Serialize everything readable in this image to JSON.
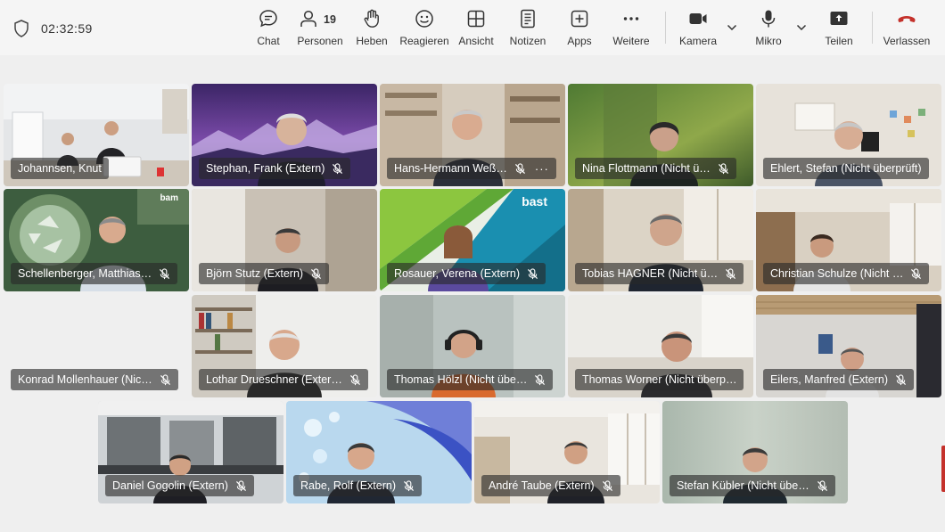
{
  "meeting": {
    "timer": "02:32:59"
  },
  "toolbar": {
    "chat": "Chat",
    "people": "Personen",
    "people_count": "19",
    "raise_hand": "Heben",
    "react": "Reagieren",
    "view": "Ansicht",
    "notes": "Notizen",
    "apps": "Apps",
    "more": "Weitere",
    "camera": "Kamera",
    "mic": "Mikro",
    "share": "Teilen",
    "leave": "Verlassen"
  },
  "tiles": [
    {
      "name": "Johannsen, Knut",
      "muted": false,
      "scene": "office-desk"
    },
    {
      "name": "Stephan, Frank (Extern)",
      "muted": true,
      "scene": "purple-mountains"
    },
    {
      "name": "Hans-Hermann Weß…",
      "muted": true,
      "more": "···",
      "scene": "library"
    },
    {
      "name": "Nina Flottmann (Nicht ü…",
      "muted": true,
      "scene": "green-blur"
    },
    {
      "name": "Ehlert, Stefan (Nicht überprüft)",
      "muted": false,
      "scene": "office-wall"
    },
    {
      "name": "Schellenberger, Matthias…",
      "muted": true,
      "scene": "recycling",
      "logo": "bam"
    },
    {
      "name": "Björn Stutz (Extern)",
      "muted": true,
      "scene": "grey-room"
    },
    {
      "name": "Rosauer, Verena (Extern)",
      "muted": true,
      "scene": "bast-green",
      "logo": "bast"
    },
    {
      "name": "Tobias HAGNER (Nicht ü…",
      "muted": true,
      "scene": "window-office"
    },
    {
      "name": "Christian Schulze (Nicht …",
      "muted": true,
      "scene": "wood-office"
    },
    {
      "name": "Konrad Mollenhauer (Nic…",
      "muted": true,
      "scene": "none"
    },
    {
      "name": "Lothar Drueschner (Exter…",
      "muted": true,
      "scene": "bookshelf"
    },
    {
      "name": "Thomas Hölzl (Nicht übe…",
      "muted": true,
      "scene": "headset"
    },
    {
      "name": "Thomas Worner (Nicht überp…",
      "muted": true,
      "scene": "bright-office"
    },
    {
      "name": "Eilers, Manfred (Extern)",
      "muted": true,
      "scene": "meeting-room"
    },
    {
      "name": "Daniel Gogolin (Extern)",
      "muted": true,
      "scene": "lab"
    },
    {
      "name": "Rabe, Rolf (Extern)",
      "muted": true,
      "scene": "blue-drops"
    },
    {
      "name": "André Taube (Extern)",
      "muted": true,
      "scene": "open-office"
    },
    {
      "name": "Stefan Kübler (Nicht übe…",
      "muted": true,
      "scene": "pale-blur"
    }
  ],
  "logos": {
    "bast": "bast",
    "bam": "bam"
  },
  "colors": {
    "leave_red": "#c4312b",
    "toolbar_bg": "#f5f5f5",
    "stage_bg": "#efefef"
  }
}
